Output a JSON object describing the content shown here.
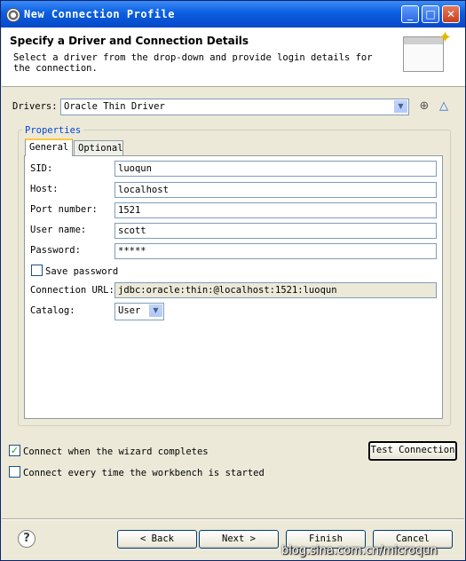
{
  "window": {
    "title": "New Connection Profile",
    "min": "_",
    "max": "□",
    "close": "✕"
  },
  "header": {
    "title": "Specify a Driver and Connection Details",
    "description": "Select a driver from the drop-down and provide login details for the connection."
  },
  "drivers": {
    "label": "Drivers:",
    "value": "Oracle Thin Driver"
  },
  "properties": {
    "group_label": "Properties",
    "tabs": [
      "General",
      "Optional"
    ],
    "fields": {
      "sid": {
        "label": "SID:",
        "value": "luoqun"
      },
      "host": {
        "label": "Host:",
        "value": "localhost"
      },
      "port": {
        "label": "Port number:",
        "value": "1521"
      },
      "user": {
        "label": "User name:",
        "value": "scott"
      },
      "password": {
        "label": "Password:",
        "value": "*****"
      },
      "save_password": {
        "label": "Save password",
        "checked": false
      },
      "url": {
        "label": "Connection URL:",
        "value": "jdbc:oracle:thin:@localhost:1521:luoqun"
      },
      "catalog": {
        "label": "Catalog:",
        "value": "User"
      }
    }
  },
  "options": {
    "connect_wizard": {
      "label": "Connect when the wizard completes",
      "checked": true
    },
    "connect_startup": {
      "label": "Connect every time the workbench is started",
      "checked": false
    }
  },
  "buttons": {
    "test": "Test Connection",
    "back": "< Back",
    "next": "Next >",
    "finish": "Finish",
    "cancel": "Cancel",
    "help": "?"
  },
  "watermark": "blog.sina.com.cn/microqun",
  "icons": {
    "add_driver": "new-driver-icon",
    "edit_driver": "edit-driver-icon"
  }
}
